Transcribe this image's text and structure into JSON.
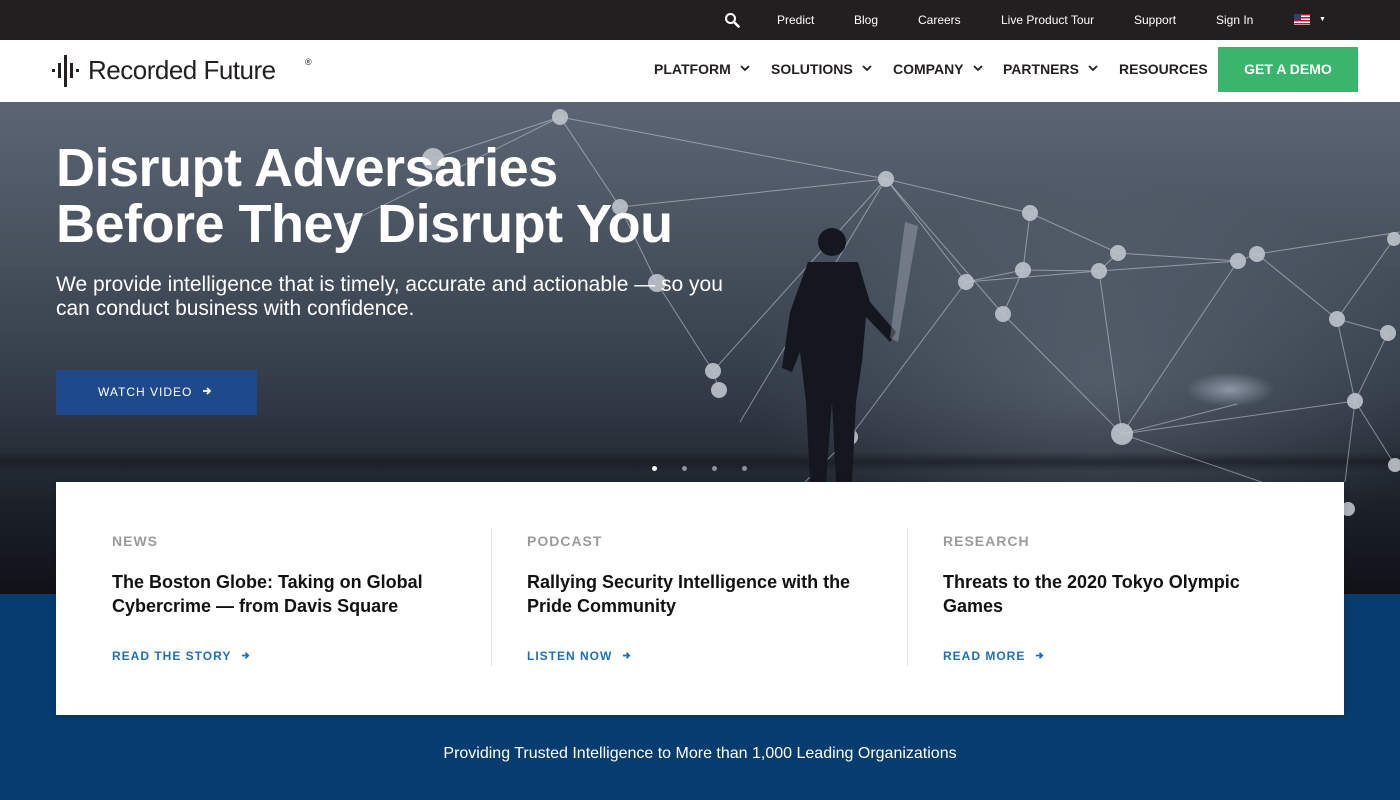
{
  "utility_nav": {
    "links": [
      "Predict",
      "Blog",
      "Careers",
      "Live Product Tour",
      "Support",
      "Sign In"
    ]
  },
  "brand": {
    "name": "Recorded Future",
    "reg_mark": "®",
    "accent_green": "#3ab56c",
    "primary_blue": "#1e4a8b",
    "band_blue": "#063d6e"
  },
  "main_nav": {
    "items": [
      "PLATFORM",
      "SOLUTIONS",
      "COMPANY",
      "PARTNERS",
      "RESOURCES"
    ],
    "cta": "GET A DEMO"
  },
  "hero": {
    "title_line1": "Disrupt Adversaries",
    "title_line2": "Before They Disrupt You",
    "subtitle": "We provide intelligence that is timely, accurate and actionable — so you can conduct business with confidence.",
    "button": "WATCH VIDEO",
    "slides": 4,
    "active_slide": 1
  },
  "cards": [
    {
      "category": "NEWS",
      "title": "The Boston Globe: Taking on Global Cybercrime — from Davis Square",
      "link": "READ THE STORY"
    },
    {
      "category": "PODCAST",
      "title": "Rallying Security Intelligence with the Pride Community",
      "link": "LISTEN NOW"
    },
    {
      "category": "RESEARCH",
      "title": "Threats to the 2020 Tokyo Olympic Games",
      "link": "READ MORE"
    }
  ],
  "band": {
    "text": "Providing Trusted Intelligence to More than 1,000 Leading Organizations"
  },
  "icons": {
    "search": "search-icon",
    "flag": "us-flag-icon",
    "chevron": "chevron-down-icon",
    "arrow": "arrow-right-icon"
  }
}
